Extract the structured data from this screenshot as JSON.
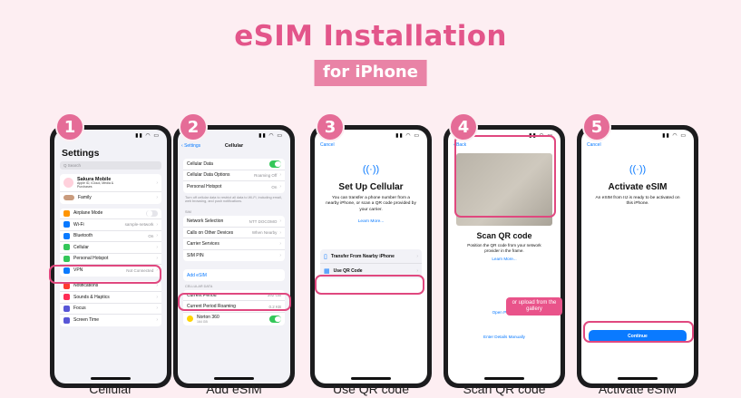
{
  "title": "eSIM Installation",
  "subtitle": "for iPhone",
  "steps": [
    {
      "number": "1",
      "caption": "Cellular"
    },
    {
      "number": "2",
      "caption": "Add eSIM"
    },
    {
      "number": "3",
      "caption": "Use QR code"
    },
    {
      "number": "4",
      "caption": "Scan QR code"
    },
    {
      "number": "5",
      "caption": "Activate eSIM"
    }
  ],
  "screen1": {
    "heading": "Settings",
    "search": "Q Search",
    "account_name": "Sakura Mobile",
    "account_sub": "Apple ID, iCloud, Media & Purchases",
    "family": "Family",
    "rows": [
      {
        "label": "Airplane Mode",
        "value": "",
        "color": "#ff9500"
      },
      {
        "label": "Wi-Fi",
        "value": "sample-network",
        "color": "#0a7aff"
      },
      {
        "label": "Bluetooth",
        "value": "On",
        "color": "#0a7aff"
      },
      {
        "label": "Cellular",
        "value": "",
        "color": "#34c759"
      },
      {
        "label": "Personal Hotspot",
        "value": "",
        "color": "#34c759"
      },
      {
        "label": "VPN",
        "value": "Not Connected",
        "color": "#0a7aff"
      }
    ],
    "rows2": [
      {
        "label": "Notifications",
        "color": "#ff3b30"
      },
      {
        "label": "Sounds & Haptics",
        "color": "#ff2d55"
      },
      {
        "label": "Focus",
        "color": "#5856d6"
      },
      {
        "label": "Screen Time",
        "color": "#5856d6"
      }
    ]
  },
  "screen2": {
    "back": "Settings",
    "title": "Cellular",
    "rows": [
      {
        "label": "Cellular Data",
        "value": ""
      },
      {
        "label": "Cellular Data Options",
        "value": "Roaming Off"
      },
      {
        "label": "Personal Hotspot",
        "value": "On"
      }
    ],
    "note": "Turn off cellular data to restrict all data to Wi-Fi, including email, web browsing, and push notifications.",
    "section": "SIM",
    "rows_sim": [
      {
        "label": "Network Selection",
        "value": "NTT DOCOMO"
      },
      {
        "label": "Calls on Other Devices",
        "value": "When Nearby"
      },
      {
        "label": "Carrier Services",
        "value": ""
      },
      {
        "label": "SIM PIN",
        "value": ""
      }
    ],
    "add_esim": "Add eSIM",
    "data_section": "CELLULAR DATA",
    "rows_data": [
      {
        "label": "Current Period",
        "value": "392 GB"
      },
      {
        "label": "Current Period Roaming",
        "value": "0.2 KB"
      }
    ],
    "app_name": "Norton 360",
    "app_size": "164 GB"
  },
  "screen3": {
    "cancel": "Cancel",
    "heading": "Set Up Cellular",
    "body": "You can transfer a phone number from a nearby iPhone, or scan a QR code provided by your carrier.",
    "learn_more": "Learn More...",
    "opt1": "Transfer From Nearby iPhone",
    "opt2": "Use QR Code"
  },
  "screen4": {
    "back": "Back",
    "heading": "Scan QR code",
    "body": "Position the QR code from your network provider in the frame.",
    "learn_more": "Learn More...",
    "bubble": "or upload from the gallery",
    "open_photos": "Open Photos",
    "manual": "Enter Details Manually"
  },
  "screen5": {
    "cancel": "Cancel",
    "heading": "Activate eSIM",
    "body": "An eSIM from IIJ is ready to be activated on this iPhone.",
    "button": "Continue"
  }
}
